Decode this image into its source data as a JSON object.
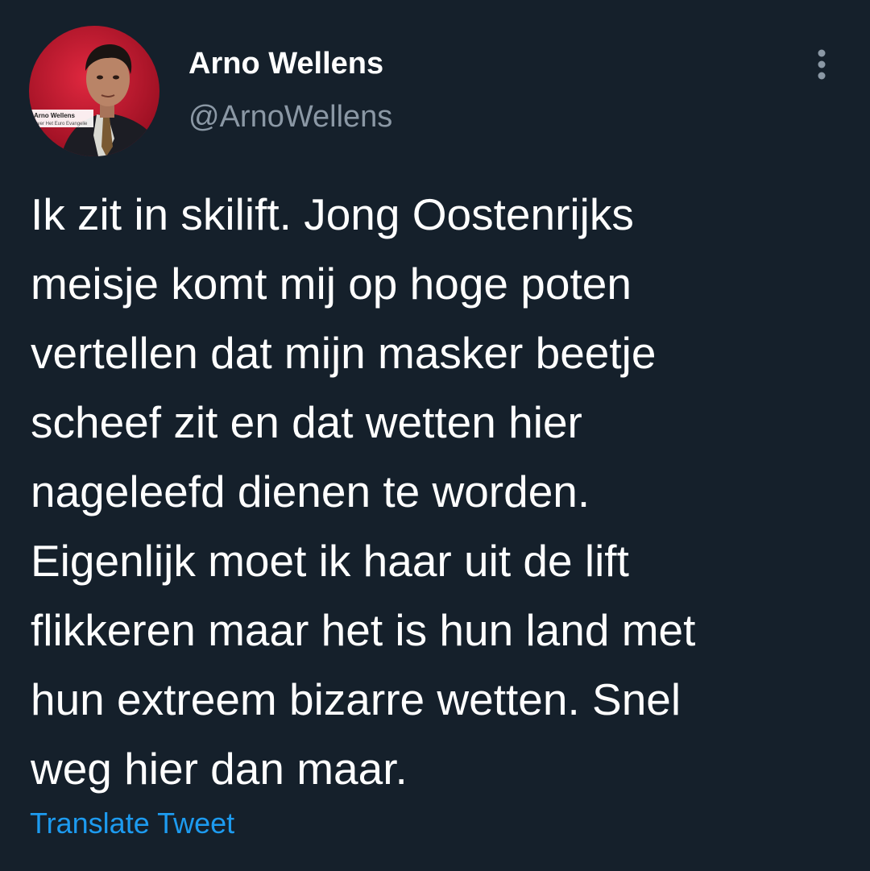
{
  "author": {
    "display_name": "Arno Wellens",
    "handle": "@ArnoWellens",
    "avatar_caption_name": "Arno Wellens",
    "avatar_caption_sub": "Over Het Euro Evangelie"
  },
  "menu": {
    "icon": "more-vertical-icon"
  },
  "tweet": {
    "lines": [
      "Ik zit in skilift. Jong Oostenrijks",
      "meisje komt mij op hoge poten",
      "vertellen dat mijn masker beetje",
      "scheef zit en dat wetten hier",
      "nageleefd dienen te worden.",
      "Eigenlijk moet ik haar uit de lift",
      "flikkeren maar het is hun land met",
      "hun extreem bizarre wetten. Snel",
      "weg hier dan maar."
    ]
  },
  "actions": {
    "translate_label": "Translate Tweet"
  },
  "colors": {
    "background": "#15202b",
    "text": "#ffffff",
    "secondary_text": "#8b98a5",
    "link": "#1d9bf0",
    "avatar_background": "#c4122f"
  }
}
